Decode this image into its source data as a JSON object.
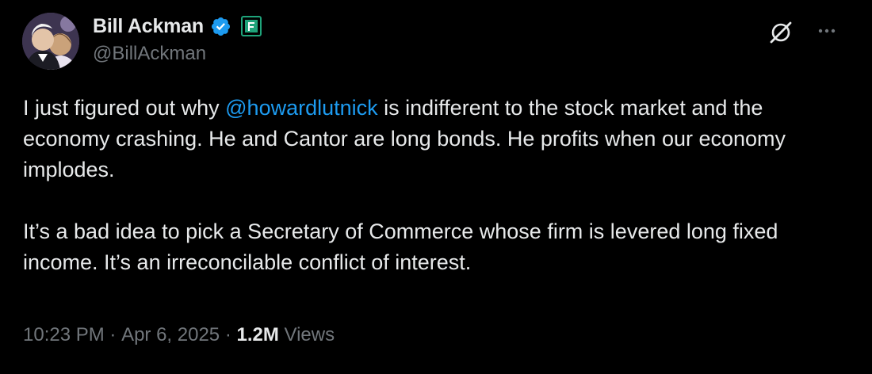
{
  "author": {
    "display_name": "Bill Ackman",
    "handle": "@BillAckman"
  },
  "icons": {
    "verified": "verified-badge-icon",
    "affiliate": "affiliate-badge-icon",
    "grok": "grok-icon",
    "more": "more-options-icon"
  },
  "colors": {
    "background": "#000000",
    "text": "#e7e9ea",
    "secondary": "#71767b",
    "accent": "#1d9bf0",
    "affiliate": "#1fa37a"
  },
  "tweet": {
    "p1_before": "I just figured out why ",
    "mention": "@howardlutnick",
    "p1_after": " is indifferent to the stock market and the economy crashing. He and Cantor are long bonds. He profits when our economy implodes.",
    "p2": "It’s a bad idea to pick a Secretary of Commerce whose firm is levered long fixed income. It’s an irreconcilable conflict of interest."
  },
  "meta": {
    "time": "10:23 PM",
    "sep1": " · ",
    "date": "Apr 6, 2025",
    "sep2": " · ",
    "views_count": "1.2M",
    "views_label": " Views"
  }
}
